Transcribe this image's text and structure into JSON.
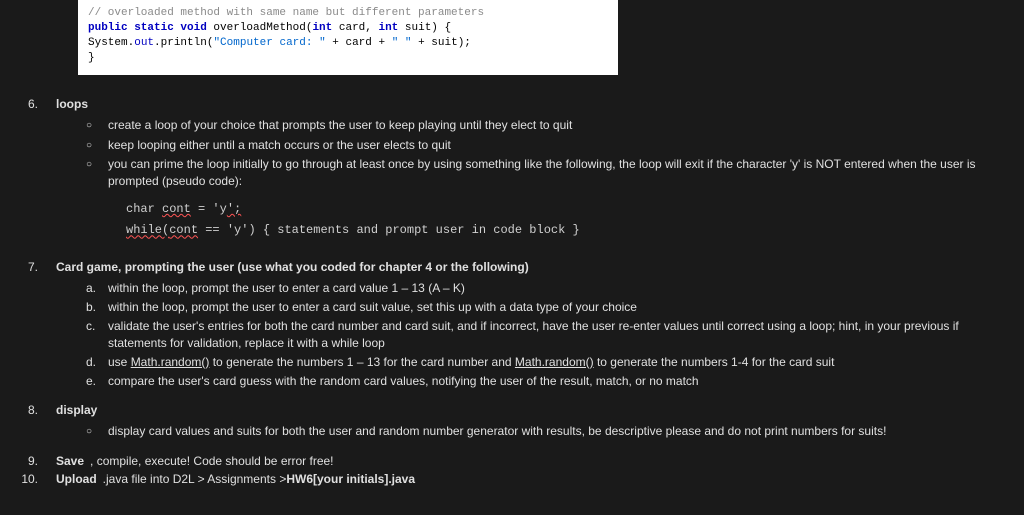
{
  "code_snippet": {
    "comment": "// overloaded method with same name but different parameters",
    "line2_kw1": "public static void",
    "line2_method": " overloadMethod(",
    "line2_kw2": "int",
    "line2_p1": " card, ",
    "line2_kw3": "int",
    "line2_p2": " suit) {",
    "line3_a": "        System.",
    "line3_out": "out",
    "line3_b": ".println(",
    "line3_str1": "\"Computer card: \"",
    "line3_c": " + card + ",
    "line3_str2": "\" \"",
    "line3_d": " + suit);",
    "line4": "}"
  },
  "item6": {
    "num": "6.",
    "title": "loops",
    "sub": [
      "create a loop of your choice that prompts the user to keep playing until they elect to quit",
      "keep looping either until a match occurs or the user elects to quit",
      "you can prime the loop initially to go through at least once by using something like the following, the loop will exit if the character 'y' is NOT entered when the user is prompted (pseudo code):"
    ],
    "pseudo_line1_a": "char ",
    "pseudo_line1_b": "cont",
    "pseudo_line1_c": " = 'y",
    "pseudo_line1_d": "';",
    "pseudo_line2_a": "while(",
    "pseudo_line2_b": "cont",
    "pseudo_line2_c": " == 'y')  { statements and prompt user in code block }"
  },
  "item7": {
    "num": "7.",
    "title": "Card game, prompting the user (use what you coded for chapter 4 or the following)",
    "labels": [
      "a.",
      "b.",
      "c.",
      "d.",
      "e."
    ],
    "sub_a": "within the loop, prompt the user to enter a card value 1 – 13 (A – K)",
    "sub_b": "within the loop, prompt the user to enter a card suit value, set this up with a data type of your choice",
    "sub_c": "validate the user's entries for both the card number and card suit, and if incorrect, have the user re-enter values until correct using a loop; hint, in your previous if statements for validation, replace it with a while loop",
    "sub_d_pre": "use ",
    "sub_d_mr1": "Math.random()",
    "sub_d_mid": " to generate the numbers 1 – 13 for the card number and ",
    "sub_d_mr2": "Math.random()",
    "sub_d_post": " to generate the numbers 1-4 for the card suit",
    "sub_e": "compare the user's card guess with the random card values, notifying the user of the result, match, or no match"
  },
  "item8": {
    "num": "8.",
    "title": "display",
    "sub": [
      "display card values and suits for both the user and random number generator with results, be descriptive please and do not print numbers for suits!"
    ]
  },
  "item9": {
    "num": "9.",
    "title": "Save",
    "rest": ", compile, execute!   Code should be error free!"
  },
  "item10": {
    "num": "10.",
    "title": "Upload",
    "rest_a": " .java file into D2L > Assignments > ",
    "rest_b": "HW6[your initials].java"
  }
}
